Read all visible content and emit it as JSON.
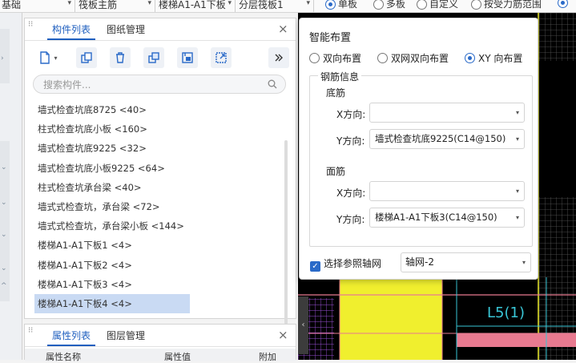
{
  "toolbar": {
    "combo1": "基础",
    "combo2": "筏板主筋",
    "combo3": "楼梯A1-A1下板",
    "combo4": "分层筏板1",
    "radios": [
      "单板",
      "多板",
      "自定义",
      "按受力筋范围"
    ]
  },
  "component_panel": {
    "tabs": [
      "构件列表",
      "图纸管理"
    ],
    "search_placeholder": "搜索构件...",
    "items": [
      "墙式检查坑底8725 <40>",
      "柱式检查坑底小板 <160>",
      "墙式检查坑底9225 <32>",
      "墙式检查坑底小板9225 <64>",
      "柱式检查坑承台梁 <40>",
      "墙式式检查坑，承台梁 <72>",
      "墙式式检查坑，承台梁小板 <144>",
      "楼梯A1-A1下板1 <4>",
      "楼梯A1-A1下板2 <4>",
      "楼梯A1-A1下板3 <4>",
      "楼梯A1-A1下板4 <4>"
    ],
    "selected_index": 10
  },
  "property_panel": {
    "tabs": [
      "属性列表",
      "图层管理"
    ],
    "columns": [
      "属性名称",
      "属性值",
      "附加"
    ]
  },
  "dialog": {
    "title": "智能布置",
    "layout_options": [
      "双向布置",
      "双网双向布置",
      "XY 向布置"
    ],
    "selected_option": 2,
    "rebar_group": "钢筋信息",
    "bottom": {
      "title": "底筋",
      "x_label": "X方向:",
      "x_value": "",
      "y_label": "Y方向:",
      "y_value": "墙式检查坑底9225(C14@150)"
    },
    "top": {
      "title": "面筋",
      "x_label": "X方向:",
      "x_value": "",
      "y_label": "Y方向:",
      "y_value": "楼梯A1-A1下板3(C14@150)"
    },
    "checkbox_label": "选择参照轴网",
    "checkbox_checked": true,
    "axis_value": "轴网-2"
  },
  "canvas": {
    "label": "L5(1)",
    "colors": {
      "background": "#000000",
      "grid": "#5a5a5a",
      "pink": "#e87a90",
      "yellow": "#f0ef2e",
      "purple": "#9a4fd6",
      "cyan": "#39c6d6"
    }
  }
}
